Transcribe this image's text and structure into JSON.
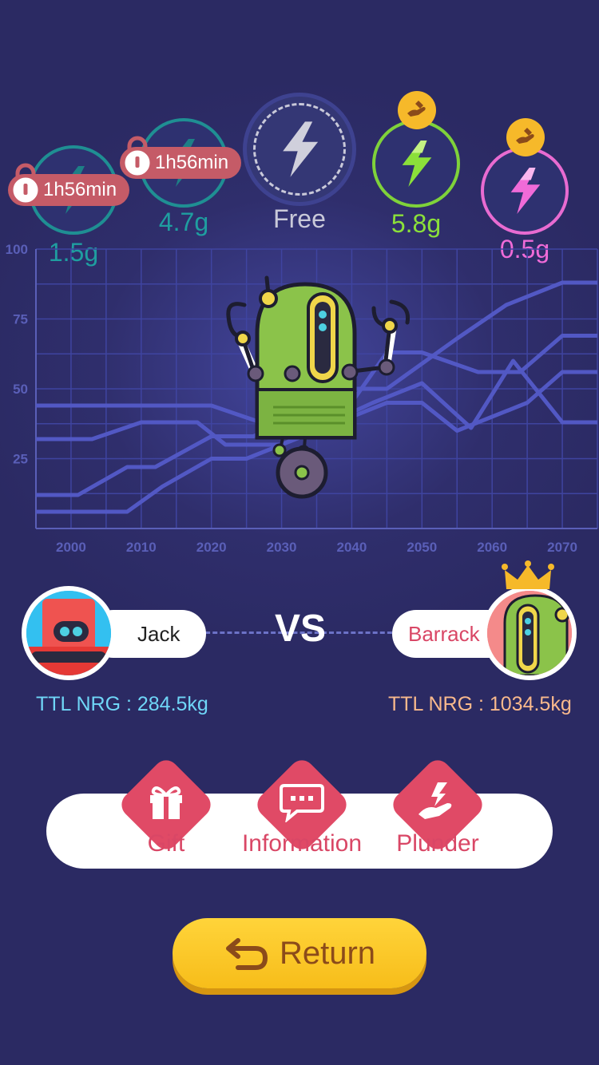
{
  "energy": [
    {
      "value": "1.5g",
      "timer": "1h56min",
      "state": "locked",
      "color": "#2bb3b5"
    },
    {
      "value": "4.7g",
      "timer": "1h56min",
      "state": "locked",
      "color": "#2bb3b5"
    },
    {
      "value": "Free",
      "state": "free",
      "color": "#c9c9d9"
    },
    {
      "value": "5.8g",
      "state": "collectable",
      "color": "#8be03a"
    },
    {
      "value": "0.5g",
      "state": "collectable",
      "color": "#f06bd8"
    }
  ],
  "chart_data": {
    "type": "line",
    "x": [
      2000,
      2010,
      2020,
      2030,
      2040,
      2050,
      2060,
      2070
    ],
    "xlim": [
      1995,
      2075
    ],
    "ylim": [
      0,
      100
    ],
    "yticks": [
      25,
      50,
      75,
      100
    ],
    "grid": true,
    "series": [
      {
        "x": [
          1995,
          2001,
          2008,
          2012,
          2020,
          2026,
          2040,
          2045,
          2055,
          2062,
          2070,
          2075
        ],
        "values": [
          12,
          12,
          22,
          22,
          33,
          33,
          50,
          50,
          68,
          80,
          88,
          88
        ]
      },
      {
        "x": [
          1995,
          2008,
          2013,
          2020,
          2025,
          2035,
          2045,
          2050,
          2055,
          2065,
          2070,
          2075
        ],
        "values": [
          6,
          6,
          15,
          25,
          25,
          35,
          45,
          45,
          35,
          45,
          56,
          56
        ]
      },
      {
        "x": [
          1995,
          2010,
          2015,
          2020,
          2027,
          2038,
          2045,
          2050,
          2058,
          2064,
          2070,
          2075
        ],
        "values": [
          44,
          44,
          44,
          44,
          38,
          38,
          63,
          63,
          56,
          56,
          69,
          69
        ]
      },
      {
        "x": [
          1995,
          2003,
          2010,
          2018,
          2022,
          2030,
          2043,
          2050,
          2057,
          2063,
          2070,
          2075
        ],
        "values": [
          32,
          32,
          38,
          38,
          30,
          30,
          45,
          52,
          36,
          60,
          38,
          38
        ]
      }
    ]
  },
  "players": {
    "me": {
      "name": "Jack",
      "ttl": "TTL NRG : 284.5kg"
    },
    "vs": "VS",
    "opponent": {
      "name": "Barrack",
      "ttl": "TTL NRG : 1034.5kg"
    }
  },
  "actions": {
    "gift": "Gift",
    "information": "Information",
    "plunder": "Plunder"
  },
  "return_label": "Return",
  "colors": {
    "me": "#6fd6f7",
    "opponent": "#f9b98c",
    "accent": "#e04a66",
    "button": "#f9c82a"
  }
}
